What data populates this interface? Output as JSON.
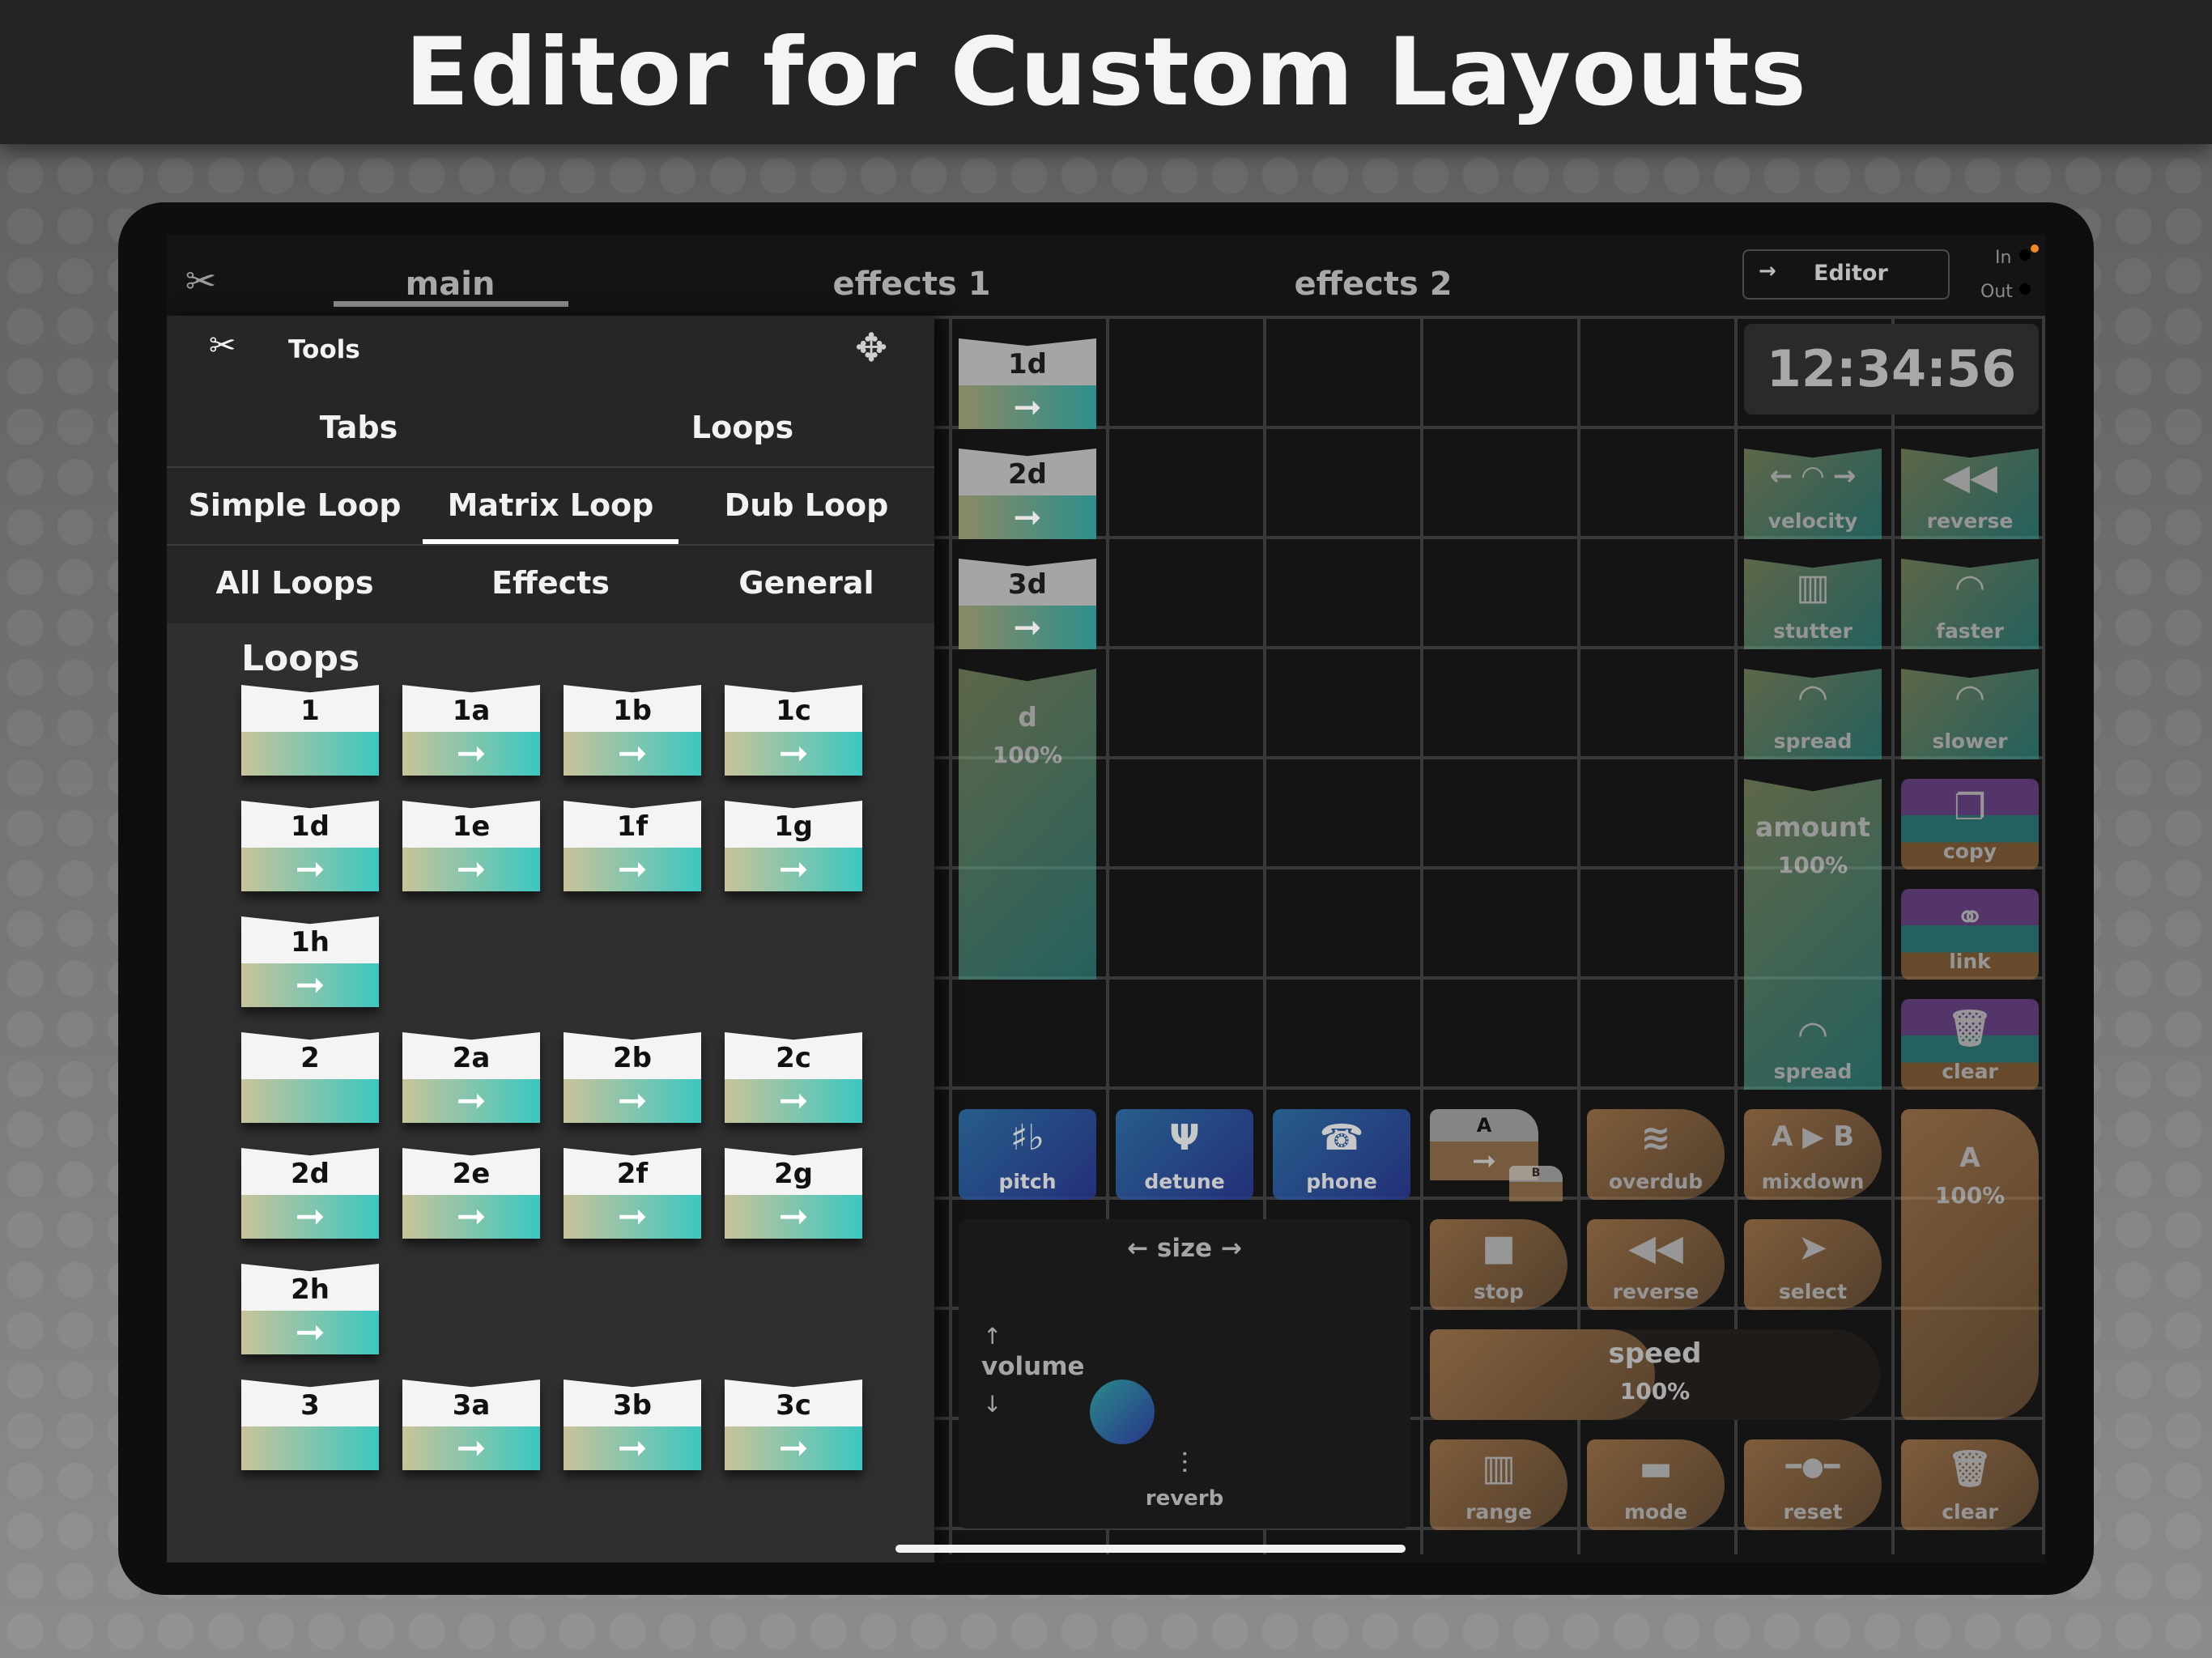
{
  "banner": {
    "title": "Editor for Custom Layouts"
  },
  "topbar": {
    "tabs": [
      "main",
      "effects 1",
      "effects 2"
    ],
    "editor_label": "Editor",
    "editor_arrow": "→",
    "in_label": "In",
    "out_label": "Out",
    "in_dot_color": "#f08a24"
  },
  "clock": "12:34:56",
  "panel": {
    "tools_label": "Tools",
    "row1": [
      "Tabs",
      "Loops"
    ],
    "row2": [
      "Simple Loop",
      "Matrix Loop",
      "Dub Loop"
    ],
    "row2_selected": "Matrix Loop",
    "row3": [
      "All Loops",
      "Effects",
      "General"
    ],
    "section_title": "Loops",
    "tiles": [
      [
        "1",
        "1a",
        "1b",
        "1c"
      ],
      [
        "1d",
        "1e",
        "1f",
        "1g"
      ],
      [
        "1h"
      ],
      [
        "2",
        "2a",
        "2b",
        "2c"
      ],
      [
        "2d",
        "2e",
        "2f",
        "2g"
      ],
      [
        "2h"
      ],
      [
        "3",
        "3a",
        "3b",
        "3c"
      ]
    ],
    "tiles_without_arrow": [
      "1",
      "2",
      "3"
    ]
  },
  "grid": {
    "loop_cells": [
      "1d",
      "2d",
      "3d"
    ],
    "volume_cell": {
      "label": "d",
      "value": "100%"
    },
    "right_top": [
      {
        "label": "velocity",
        "icon": "← ◠ →"
      },
      {
        "label": "reverse",
        "icon": "◀◀"
      },
      {
        "label": "stutter",
        "icon": "▥"
      },
      {
        "label": "faster",
        "icon": "◠"
      },
      {
        "label": "spread",
        "icon": "◠"
      },
      {
        "label": "slower",
        "icon": "◠"
      }
    ],
    "amount": {
      "label": "amount",
      "value": "100%",
      "sub": "spread"
    },
    "purple_buttons": [
      {
        "label": "copy",
        "icon": "❐"
      },
      {
        "label": "link",
        "icon": "⚭"
      },
      {
        "label": "clear",
        "icon": "🗑"
      }
    ],
    "blue_buttons": [
      {
        "label": "pitch",
        "icon": "♯♭"
      },
      {
        "label": "detune",
        "icon": "Ψ"
      },
      {
        "label": "phone",
        "icon": "☎"
      }
    ],
    "ab_cell": {
      "a": "A",
      "b": "B"
    },
    "orange_row1": [
      {
        "label": "overdub",
        "icon": "≋"
      },
      {
        "label": "mixdown",
        "icon": "A ▶ B"
      }
    ],
    "orange_row2": [
      {
        "label": "stop",
        "icon": "■"
      },
      {
        "label": "reverse",
        "icon": "◀◀"
      },
      {
        "label": "select",
        "icon": "➤"
      }
    ],
    "speed": {
      "label": "speed",
      "value": "100%"
    },
    "orange_row3": [
      {
        "label": "range",
        "icon": "▥"
      },
      {
        "label": "mode",
        "icon": "▬"
      },
      {
        "label": "reset",
        "icon": "━●━"
      },
      {
        "label": "clear",
        "icon": "🗑"
      }
    ],
    "a_big": {
      "label": "A",
      "value": "100%"
    },
    "xy_pad": {
      "size_label": "← size →",
      "volume_label": "volume",
      "reverb_label": "reverb",
      "up": "↑",
      "down": "↓",
      "reverb_icon": "⫶"
    }
  }
}
